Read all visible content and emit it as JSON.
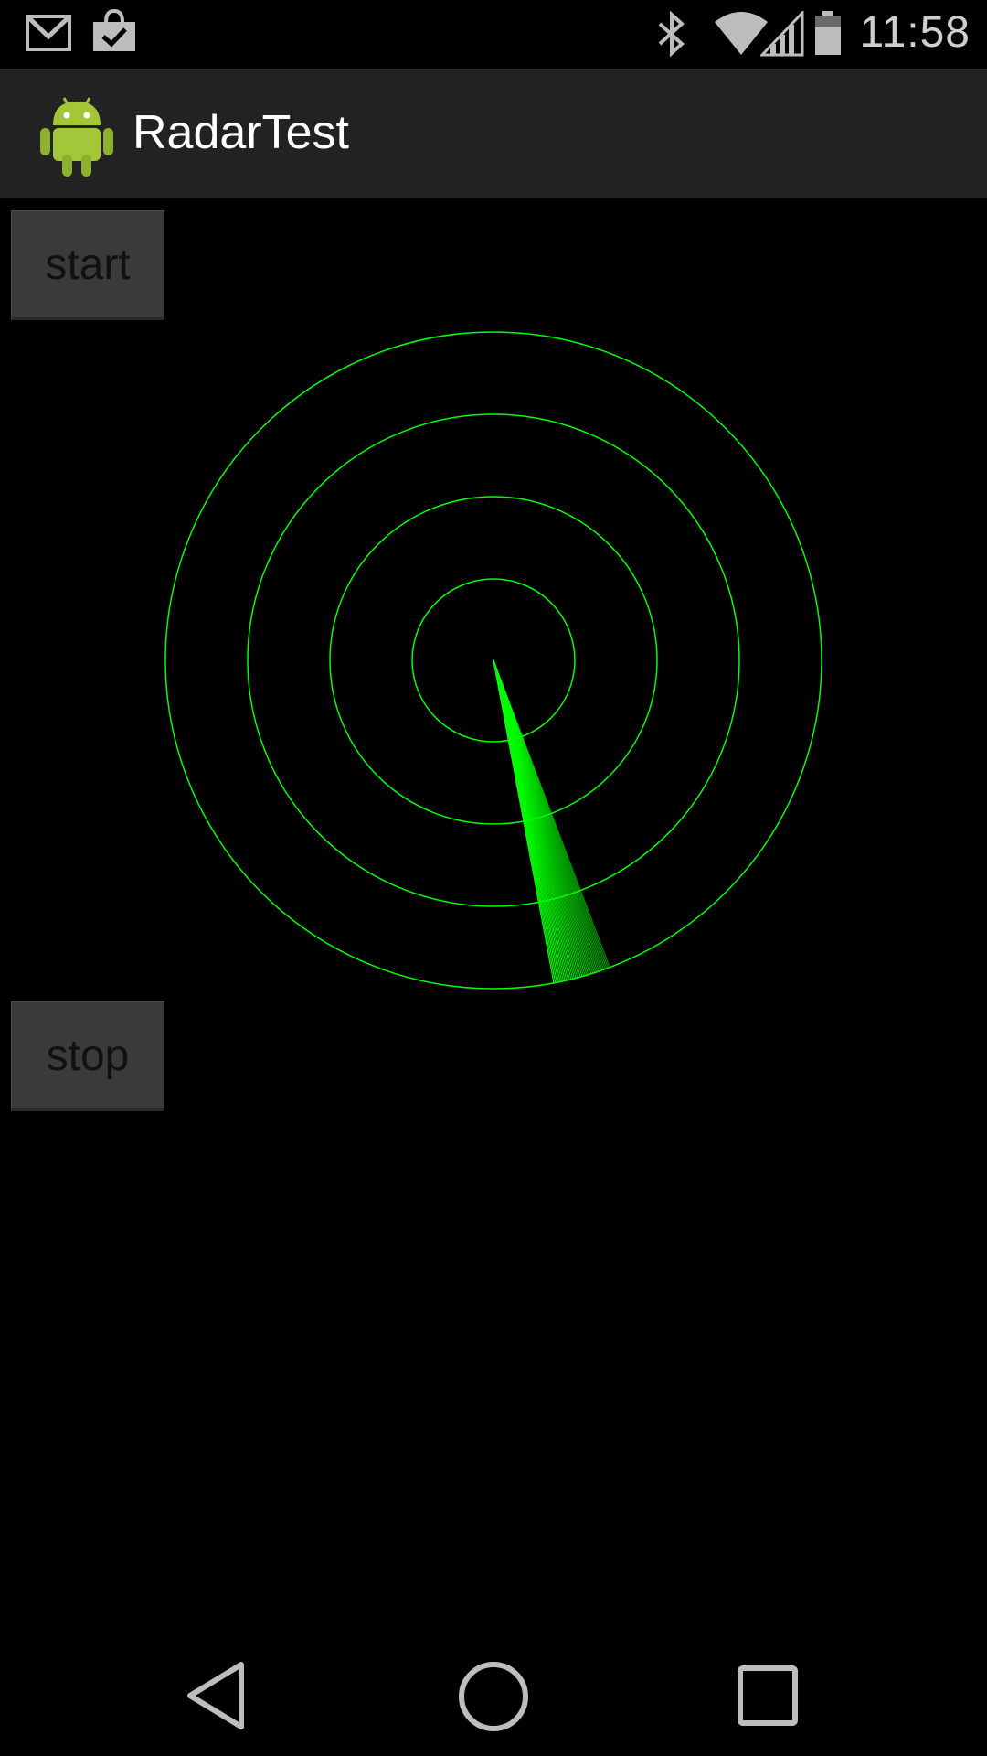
{
  "status_bar": {
    "time": "11:58",
    "icons": [
      "gmail-icon",
      "shopping-bag-icon",
      "bluetooth-icon",
      "wifi-icon",
      "signal-icon",
      "battery-icon"
    ]
  },
  "app": {
    "title": "RadarTest",
    "icon": "android-robot-icon"
  },
  "buttons": {
    "start_label": "start",
    "stop_label": "stop"
  },
  "radar": {
    "ring_count": 4,
    "color": "#00ff00",
    "sweep_angle_deg": 169
  },
  "nav_bar": {
    "icons": [
      "back-icon",
      "home-icon",
      "recents-icon"
    ]
  },
  "colors": {
    "background": "#000000",
    "action_bar": "#222222",
    "button_bg": "#3a3a3a",
    "radar_green": "#00ff00"
  }
}
